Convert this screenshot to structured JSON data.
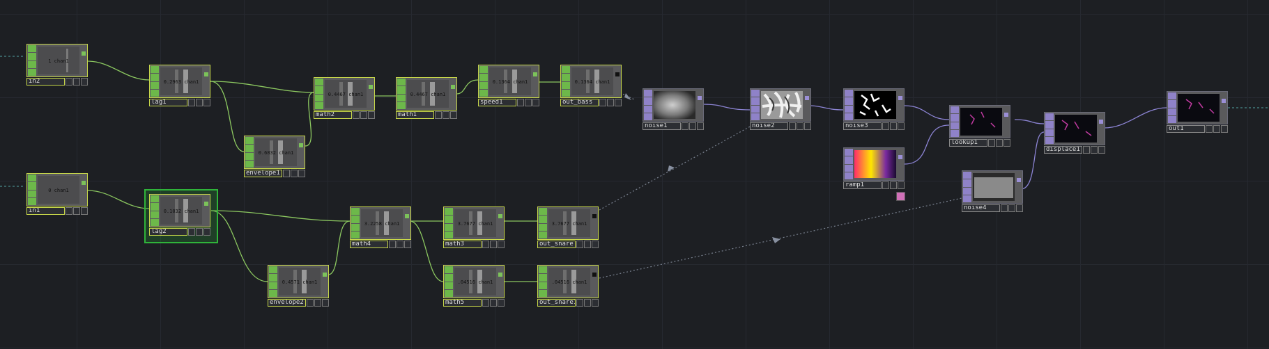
{
  "nodes": {
    "in2": {
      "name": "in2",
      "value": "1 chan1"
    },
    "lag1": {
      "name": "lag1",
      "value": "0.2963 chan1"
    },
    "envelope1": {
      "name": "envelope1",
      "value": "0.6832 chan1"
    },
    "math2": {
      "name": "math2",
      "value": "0.4467 chan1"
    },
    "math1": {
      "name": "math1",
      "value": "0.4467 chan1"
    },
    "speed1": {
      "name": "speed1",
      "value": "0.1364 chan1"
    },
    "out_bass": {
      "name": "out_bass",
      "value": "0.1364 chan1"
    },
    "in1": {
      "name": "in1",
      "value": "0 chan1"
    },
    "lag2": {
      "name": "lag2",
      "value": "0.1032 chan1"
    },
    "envelope2": {
      "name": "envelope2",
      "value": "0.4571 chan1"
    },
    "math4": {
      "name": "math4",
      "value": "3.2258 chan1"
    },
    "math3": {
      "name": "math3",
      "value": "3.7677 chan1"
    },
    "out_snare": {
      "name": "out_snare",
      "value": "3.7677 chan1"
    },
    "math5": {
      "name": "math5",
      "value": ".04516 chan1"
    },
    "out_snare1": {
      "name": "out_snare1",
      "value": ".04516 chan1"
    },
    "noise1": {
      "name": "noise1"
    },
    "noise2": {
      "name": "noise2"
    },
    "noise3": {
      "name": "noise3"
    },
    "ramp1": {
      "name": "ramp1"
    },
    "lookup1": {
      "name": "lookup1"
    },
    "noise4": {
      "name": "noise4"
    },
    "displace1": {
      "name": "displace1"
    },
    "out1": {
      "name": "out1"
    }
  },
  "colors": {
    "background": "#1d1f23",
    "chop_accent": "#6db84a",
    "chop_border": "#c8d84a",
    "top_accent": "#8f82c8",
    "chop_wire": "#8cc860",
    "top_wire": "#8c84d4",
    "export_wire": "#7a8290",
    "selection": "#2fb43a"
  }
}
